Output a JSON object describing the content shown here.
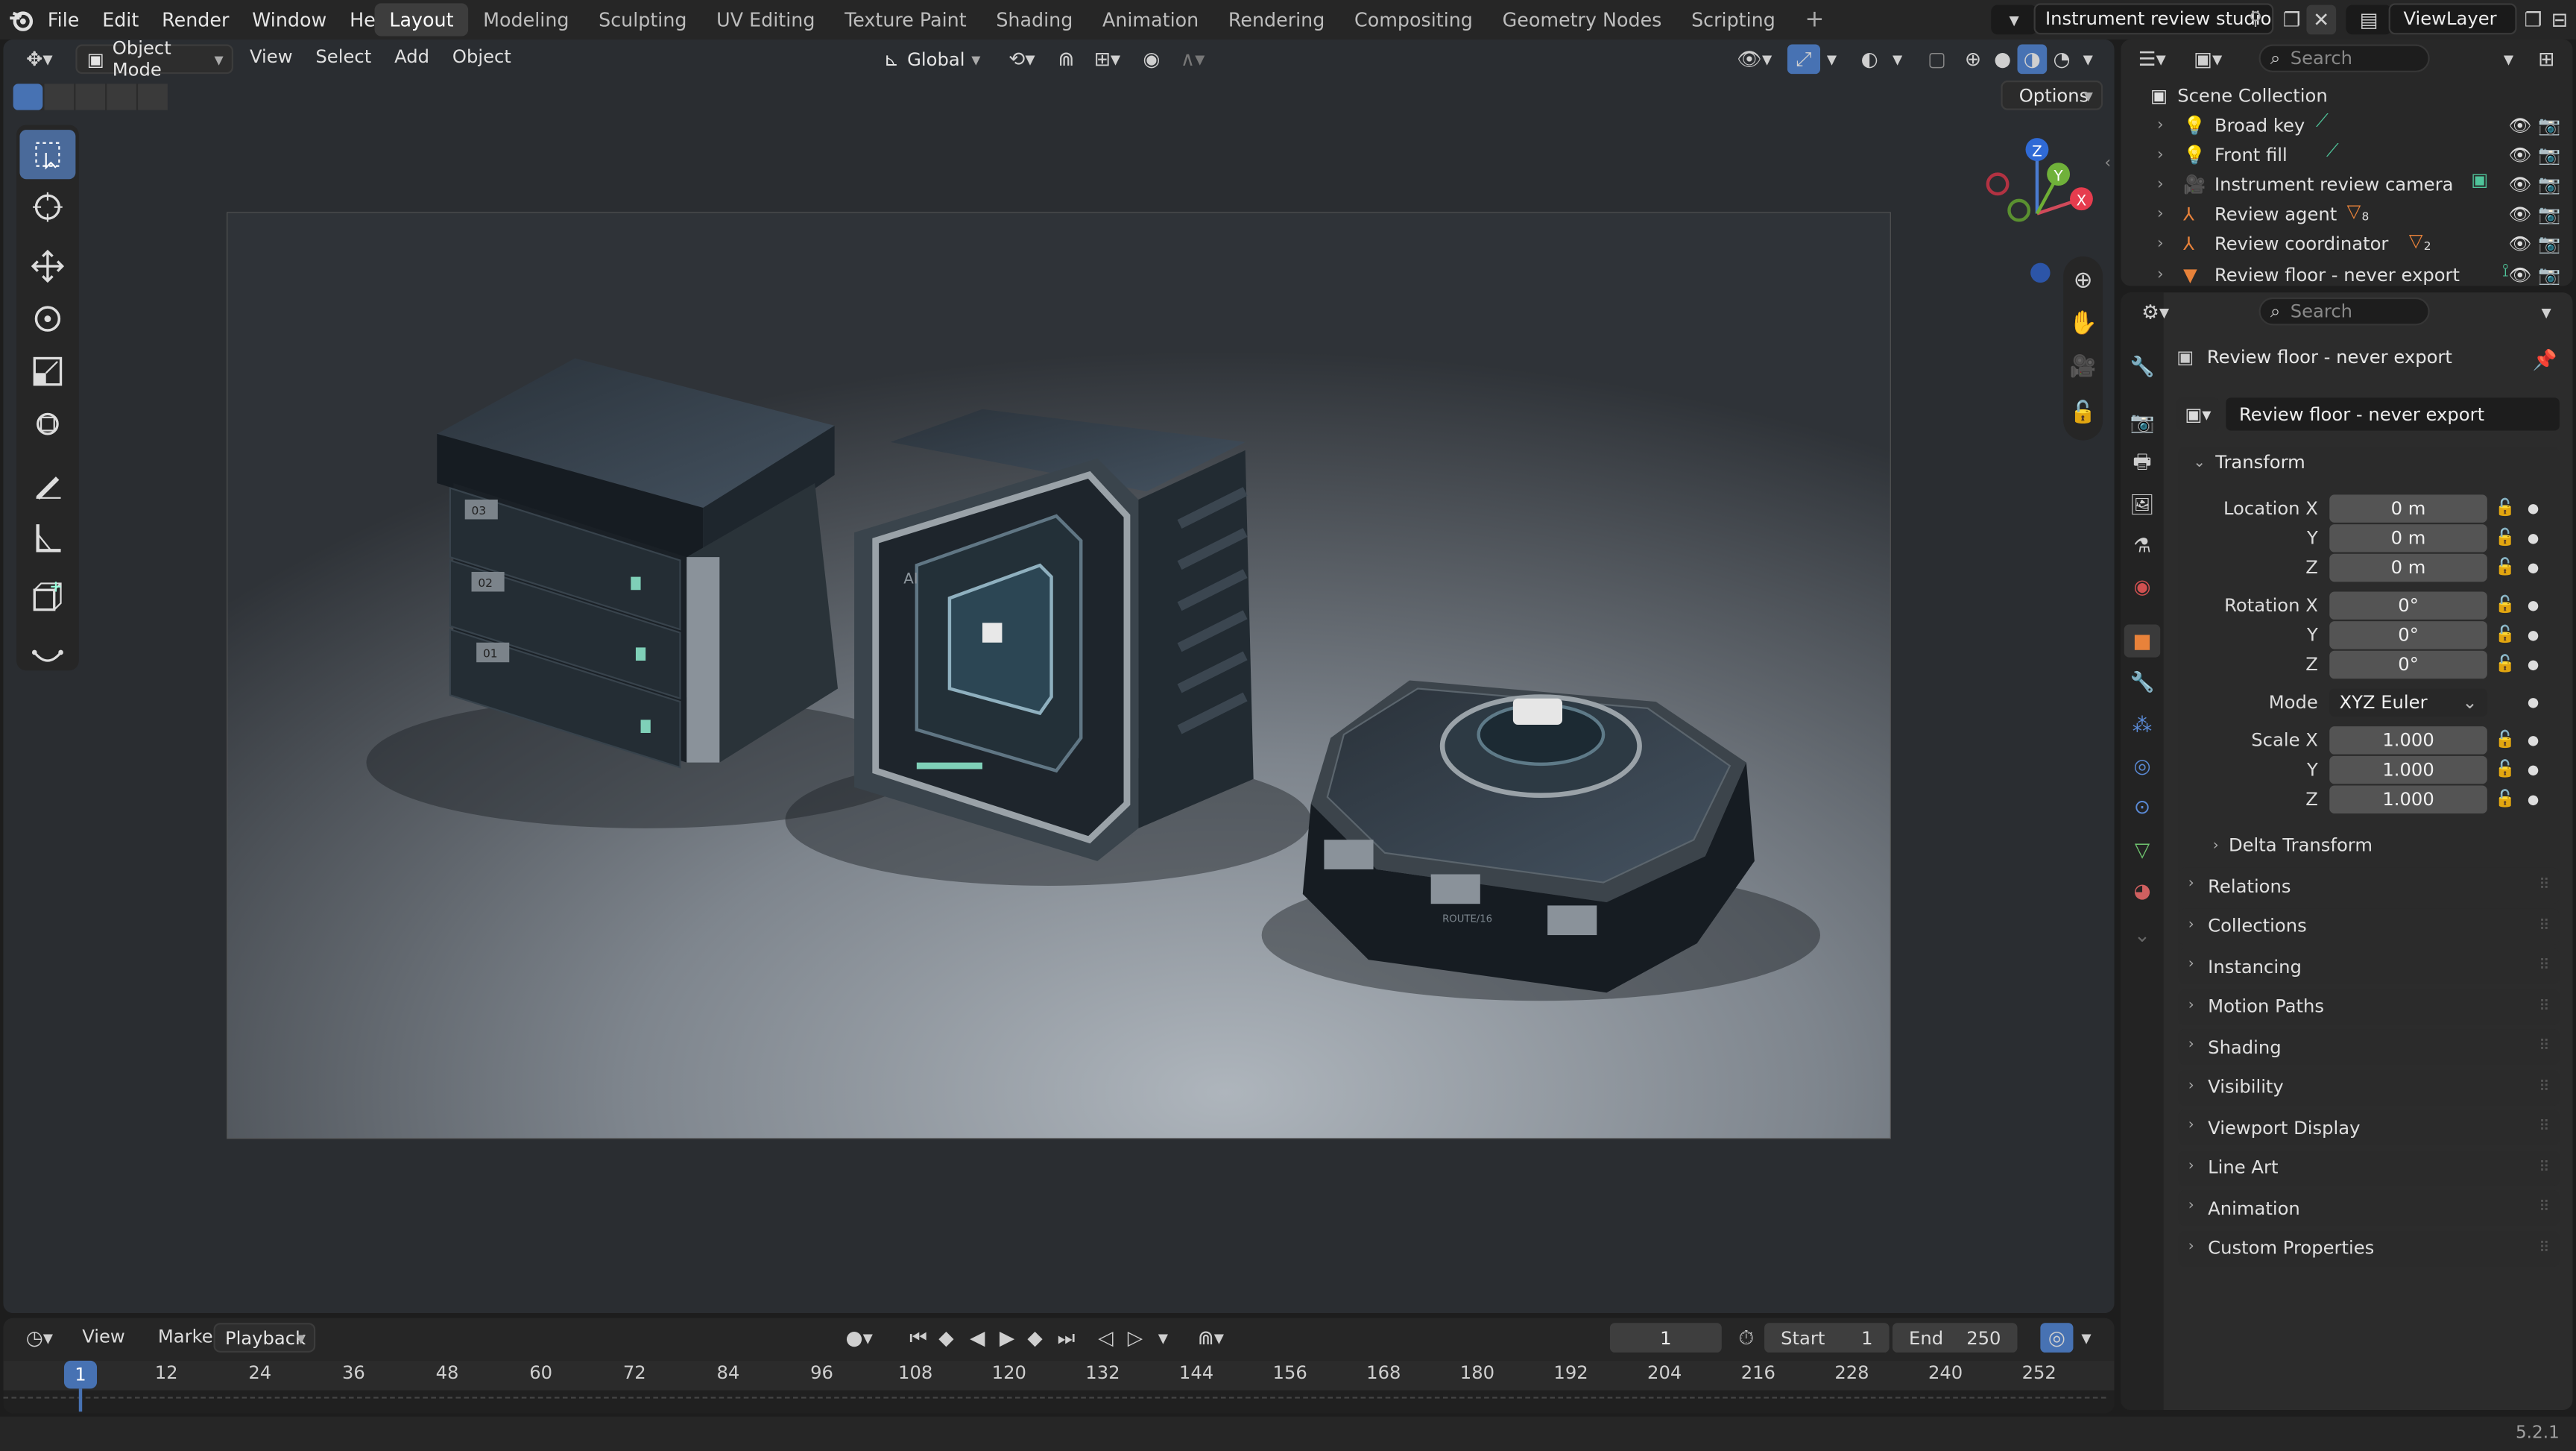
{
  "app": {
    "version": "5.2.1"
  },
  "topbar": {
    "menus": [
      "File",
      "Edit",
      "Render",
      "Window",
      "Help"
    ],
    "workspaces": [
      "Layout",
      "Modeling",
      "Sculpting",
      "UV Editing",
      "Texture Paint",
      "Shading",
      "Animation",
      "Rendering",
      "Compositing",
      "Geometry Nodes",
      "Scripting"
    ],
    "active_workspace": "Layout",
    "scene_name": "Instrument review studio",
    "view_layer": "ViewLayer"
  },
  "viewport": {
    "mode": "Object Mode",
    "menus": [
      "View",
      "Select",
      "Add",
      "Object"
    ],
    "transform_orientation": "Global",
    "options_label": "Options",
    "gizmo_labels": {
      "x": "X",
      "y": "Y",
      "z": "Z"
    },
    "crate_labels": [
      "03",
      "02",
      "01"
    ],
    "unit_label": "AI",
    "hub_label": "ROUTE/16"
  },
  "outliner": {
    "search_placeholder": "Search",
    "root": "Scene Collection",
    "items": [
      {
        "name": "Broad key",
        "icon": "light-icon",
        "data_icon": "light-data-icon"
      },
      {
        "name": "Front fill",
        "icon": "light-icon",
        "data_icon": "light-data-icon"
      },
      {
        "name": "Instrument review camera",
        "icon": "camera-icon",
        "data_icon": "camera-data-icon"
      },
      {
        "name": "Review agent",
        "icon": "empty-icon",
        "data_icon": "mesh-data-icon",
        "sub": "8"
      },
      {
        "name": "Review coordinator",
        "icon": "empty-icon",
        "data_icon": "mesh-data-icon",
        "sub": "2"
      },
      {
        "name": "Review floor - never export",
        "icon": "mesh-icon",
        "data_icon": "modifier-icon"
      }
    ]
  },
  "properties": {
    "search_placeholder": "Search",
    "object_name": "Review floor - never export",
    "datablock_name": "Review floor - never export",
    "transform_title": "Transform",
    "location": {
      "label": "Location X",
      "y_label": "Y",
      "z_label": "Z",
      "x": "0 m",
      "y": "0 m",
      "z": "0 m"
    },
    "rotation": {
      "label": "Rotation X",
      "y_label": "Y",
      "z_label": "Z",
      "x": "0°",
      "y": "0°",
      "z": "0°"
    },
    "mode_label": "Mode",
    "mode_value": "XYZ Euler",
    "scale": {
      "label": "Scale X",
      "y_label": "Y",
      "z_label": "Z",
      "x": "1.000",
      "y": "1.000",
      "z": "1.000"
    },
    "delta_transform": "Delta Transform",
    "panels": [
      "Relations",
      "Collections",
      "Instancing",
      "Motion Paths",
      "Shading",
      "Visibility",
      "Viewport Display",
      "Line Art",
      "Animation",
      "Custom Properties"
    ]
  },
  "timeline": {
    "menus": [
      "View",
      "Marker",
      "Playback"
    ],
    "current_frame": "1",
    "start_label": "Start",
    "start": "1",
    "end_label": "End",
    "end": "250",
    "ticks": [
      "1",
      "12",
      "24",
      "36",
      "48",
      "60",
      "72",
      "84",
      "96",
      "108",
      "120",
      "132",
      "144",
      "156",
      "168",
      "180",
      "192",
      "204",
      "216",
      "228",
      "240",
      "252"
    ]
  },
  "colors": {
    "accent": "#4772b3",
    "selected": "#4a6a9a",
    "orange": "#e8823a"
  }
}
